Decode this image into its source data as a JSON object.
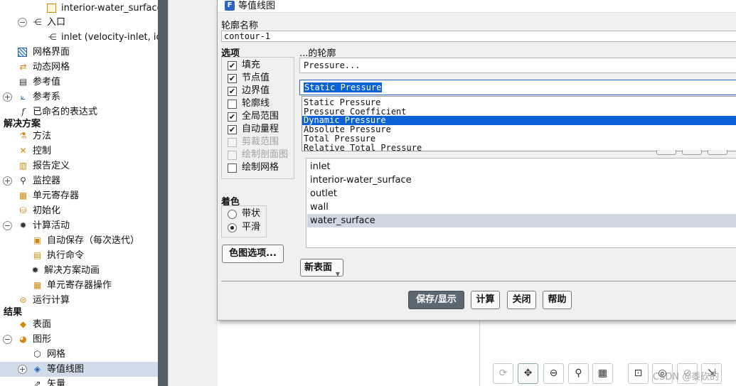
{
  "tree": {
    "items": [
      {
        "label": "interior-water_surface",
        "icon": "surface-box-icon"
      },
      {
        "label": "入口",
        "icon": "boundary-group-icon",
        "expander": "−"
      },
      {
        "label": "inlet (velocity-inlet, id=",
        "icon": "boundary-icon"
      },
      {
        "label": "网格界面",
        "icon": "mesh-interface-icon"
      },
      {
        "label": "动态网格",
        "icon": "dynamic-mesh-icon"
      },
      {
        "label": "参考值",
        "icon": "reference-values-icon"
      },
      {
        "label": "参考系",
        "icon": "reference-frame-icon",
        "expander": "+"
      },
      {
        "label": "已命名的表达式",
        "icon": "function-icon"
      },
      {
        "label": "解决方案",
        "section": true
      },
      {
        "label": "方法",
        "icon": "methods-icon"
      },
      {
        "label": "控制",
        "icon": "controls-icon"
      },
      {
        "label": "报告定义",
        "icon": "report-definitions-icon"
      },
      {
        "label": "监控器",
        "icon": "monitors-icon",
        "expander": "+"
      },
      {
        "label": "单元寄存器",
        "icon": "cell-registers-icon"
      },
      {
        "label": "初始化",
        "icon": "initialization-icon"
      },
      {
        "label": "计算活动",
        "icon": "calculation-activities-icon",
        "expander": "−"
      },
      {
        "label": "自动保存（每次迭代）",
        "icon": "autosave-icon"
      },
      {
        "label": "执行命令",
        "icon": "execute-commands-icon"
      },
      {
        "label": "解决方案动画",
        "icon": "solution-animation-icon"
      },
      {
        "label": "单元寄存器操作",
        "icon": "register-operations-icon"
      },
      {
        "label": "运行计算",
        "icon": "run-calculation-icon"
      },
      {
        "label": "结果",
        "section": true
      },
      {
        "label": "表面",
        "icon": "surfaces-icon"
      },
      {
        "label": "图形",
        "icon": "graphics-icon",
        "expander": "−"
      },
      {
        "label": "网格",
        "icon": "mesh-icon"
      },
      {
        "label": "等值线图",
        "icon": "contours-icon",
        "expander": "+",
        "selected": true
      },
      {
        "label": "矢量",
        "icon": "vectors-icon"
      }
    ]
  },
  "dialog": {
    "title": "等值线图",
    "app_icon_letter": "F",
    "contour_name_label": "轮廓名称",
    "contour_name_value": "contour-1",
    "options_label": "选项",
    "options": [
      {
        "label": "填充",
        "checked": true,
        "enabled": true
      },
      {
        "label": "节点值",
        "checked": true,
        "enabled": true
      },
      {
        "label": "边界值",
        "checked": true,
        "enabled": true
      },
      {
        "label": "轮廓线",
        "checked": false,
        "enabled": true
      },
      {
        "label": "全局范围",
        "checked": true,
        "enabled": true
      },
      {
        "label": "自动量程",
        "checked": true,
        "enabled": true
      },
      {
        "label": "剪裁范围",
        "checked": false,
        "enabled": false
      },
      {
        "label": "绘制剖面图",
        "checked": false,
        "enabled": false
      },
      {
        "label": "绘制网格",
        "checked": false,
        "enabled": true
      }
    ],
    "coloring_label": "着色",
    "coloring": [
      {
        "label": "带状",
        "selected": false
      },
      {
        "label": "平滑",
        "selected": true
      }
    ],
    "colormap_button": "色图选项...",
    "contours_of_label": "...的轮廓",
    "category_value": "Pressure...",
    "field_value": "Static Pressure",
    "field_dropdown": [
      {
        "label": "Static Pressure",
        "highlighted": false
      },
      {
        "label": "Pressure Coefficient",
        "highlighted": false
      },
      {
        "label": "Dynamic Pressure",
        "highlighted": true
      },
      {
        "label": "Absolute Pressure",
        "highlighted": false
      },
      {
        "label": "Total Pressure",
        "highlighted": false
      },
      {
        "label": "Relative Total Pressure",
        "highlighted": false
      }
    ],
    "surfaces": [
      {
        "label": "inlet",
        "selected": false
      },
      {
        "label": "interior-water_surface",
        "selected": false
      },
      {
        "label": "outlet",
        "selected": false
      },
      {
        "label": "wall",
        "selected": false
      },
      {
        "label": "water_surface",
        "selected": true
      }
    ],
    "new_surface_button": "新表面",
    "buttons": {
      "save_display": "保存/显示",
      "compute": "计算",
      "close": "关闭",
      "help": "帮助"
    }
  },
  "toolbar": {
    "icons": [
      "rotate-icon",
      "pan-icon",
      "zoom-in-out-icon",
      "zoom-icon",
      "fit-icon",
      "zoom-box-icon",
      "probe-icon",
      "ruler-icon"
    ]
  },
  "watermark": "CSDN @黍砍的"
}
